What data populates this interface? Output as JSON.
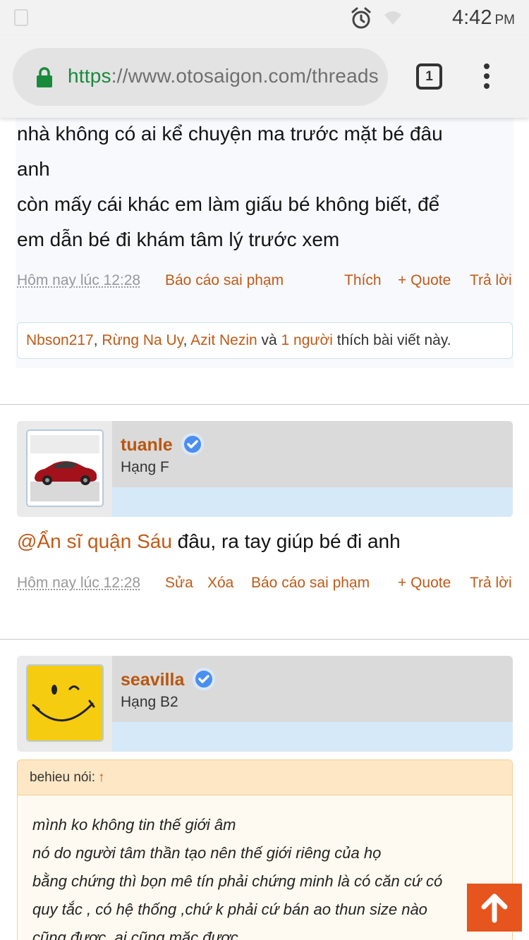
{
  "status_bar": {
    "time": "4:42",
    "ampm": "PM"
  },
  "browser": {
    "url_scheme": "https",
    "url_rest": "://www.otosaigon.com/threads",
    "tab_count": "1"
  },
  "post1": {
    "lines": [
      "nhà không có ai kể chuyện ma trước mặt bé đâu",
      "anh",
      "còn mấy cái khác em làm giấu bé không biết, để",
      "em dẫn bé đi khám tâm lý trước xem"
    ],
    "meta": {
      "time": "Hôm nay lúc 12:28",
      "report": "Báo cáo sai phạm",
      "like": "Thích",
      "quote": "+ Quote",
      "reply": "Trả lời"
    },
    "likes": {
      "user1": "Nbson217",
      "sep1": ", ",
      "user2": "Rừng Na Uy",
      "sep2": ", ",
      "user3": "Azit Nezin",
      "and": " và ",
      "others": "1 người",
      "suffix": " thích bài viết này."
    }
  },
  "post2": {
    "username": "tuanle",
    "rank": "Hạng F",
    "mention": "@Ẩn sĩ quận Sáu",
    "text": " đâu, ra tay giúp bé đi anh",
    "meta": {
      "time": "Hôm nay lúc 12:28",
      "edit": "Sửa",
      "delete": "Xóa",
      "report": "Báo cáo sai phạm",
      "quote": "+ Quote",
      "reply": "Trả lời"
    }
  },
  "post3": {
    "username": "seavilla",
    "rank": "Hạng B2",
    "quote_author": "behieu nói:",
    "quote_arrow": "↑",
    "quote_lines": [
      "mình ko không tin thế giới âm",
      "nó do người tâm thần tạo nên thế giới riêng của họ",
      "bằng chứng thì bọn mê tín phải chứng minh là có căn cứ có",
      "quy tắc , có hệ thống ,chứ k phải cứ bán ao thun size nào",
      "cũng được, ai cũng mặc được"
    ]
  },
  "colors": {
    "link": "#c15a18",
    "accent_button": "#e5551d",
    "verified": "#4a8ef0"
  },
  "icons": {
    "alarm": "alarm-clock-icon",
    "wifi": "wifi-icon",
    "lock": "lock-icon",
    "menu": "more-vert-icon",
    "scroll_top": "arrow-up-icon",
    "verified": "verified-badge-icon"
  }
}
